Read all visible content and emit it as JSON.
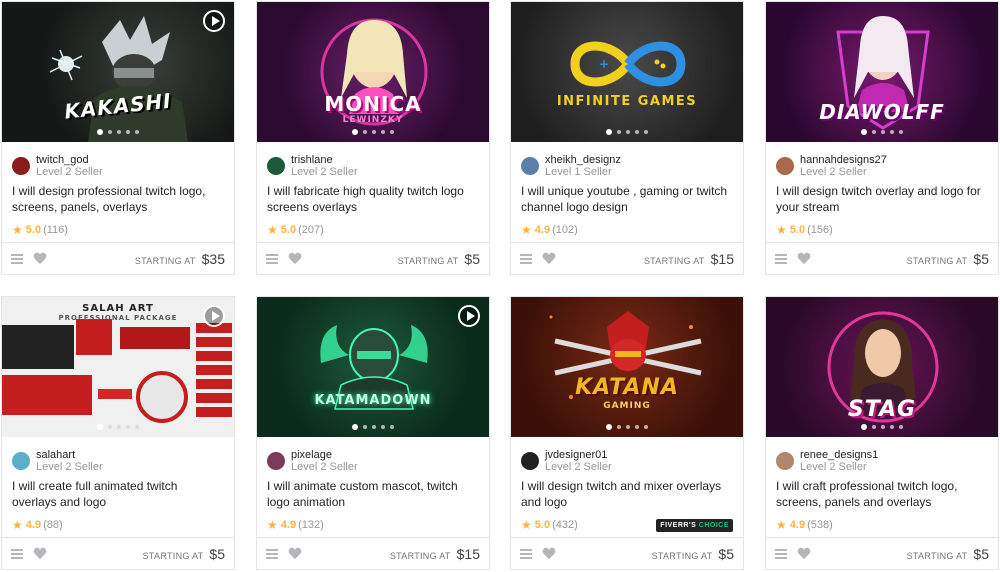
{
  "labels": {
    "starting_at": "STARTING AT"
  },
  "gigs": [
    {
      "seller": "twitch_god",
      "level": "Level 2 Seller",
      "title": "I will design professional twitch logo, screens, panels, overlays",
      "rating": "5.0",
      "reviews": "(116)",
      "price": "$35",
      "thumb_text": "KAKASHI",
      "has_video": true,
      "bg": "#151816",
      "accent": "#e8eef0",
      "avatar_color": "#8b1a1a"
    },
    {
      "seller": "trishlane",
      "level": "Level 2 Seller",
      "title": "I will fabricate high quality twitch logo screens overlays",
      "rating": "5.0",
      "reviews": "(207)",
      "price": "$5",
      "thumb_text": "MONICA",
      "thumb_sub": "LEWINZKY",
      "has_video": false,
      "bg": "#2a0a2e",
      "accent": "#ff3db8",
      "avatar_color": "#1e5a3a"
    },
    {
      "seller": "xheikh_designz",
      "level": "Level 1 Seller",
      "title": "I will unique youtube , gaming or twitch channel logo design",
      "rating": "4.9",
      "reviews": "(102)",
      "price": "$15",
      "thumb_text": "INFINITE GAMES",
      "has_video": false,
      "bg": "#2b2b2b",
      "accent": "#3aa7e8",
      "avatar_color": "#5a7fa8"
    },
    {
      "seller": "hannahdesigns27",
      "level": "Level 2 Seller",
      "title": "I will design twitch overlay and logo for your stream",
      "rating": "5.0",
      "reviews": "(156)",
      "price": "$5",
      "thumb_text": "DIAWOLFF",
      "has_video": false,
      "bg": "#3b0a3d",
      "accent": "#e23bd6",
      "avatar_color": "#a86a4a"
    },
    {
      "seller": "salahart",
      "level": "Level 2 Seller",
      "title": "I will create full animated twitch overlays and logo",
      "rating": "4.9",
      "reviews": "(88)",
      "price": "$5",
      "thumb_text": "SALAH ART",
      "thumb_sub": "PROFESSIONAL PACKAGE",
      "has_video": true,
      "bg": "#f0f0f0",
      "accent": "#c41e1e",
      "avatar_color": "#5ab0c8"
    },
    {
      "seller": "pixelage",
      "level": "Level 2 Seller",
      "title": "I will animate custom mascot, twitch logo animation",
      "rating": "4.9",
      "reviews": "(132)",
      "price": "$15",
      "thumb_text": "KATAMADOWN",
      "has_video": true,
      "bg": "#0a2a1c",
      "accent": "#3dffb0",
      "avatar_color": "#7a3a5a"
    },
    {
      "seller": "jvdesigner01",
      "level": "Level 2 Seller",
      "title": "I will design twitch and mixer overlays and logo",
      "rating": "5.0",
      "reviews": "(432)",
      "price": "$5",
      "thumb_text": "KATANA",
      "thumb_sub": "GAMING",
      "has_video": false,
      "bg": "#3a1008",
      "accent": "#f0b820",
      "avatar_color": "#222222",
      "badge_a": "FIVERR'S",
      "badge_b": "CHOICE"
    },
    {
      "seller": "renee_designs1",
      "level": "Level 2 Seller",
      "title": "I will craft professional twitch logo, screens, panels and overlays",
      "rating": "4.9",
      "reviews": "(538)",
      "price": "$5",
      "thumb_text": "STAG",
      "has_video": false,
      "bg": "#2a0a28",
      "accent": "#ff3ea8",
      "avatar_color": "#b08870"
    }
  ]
}
